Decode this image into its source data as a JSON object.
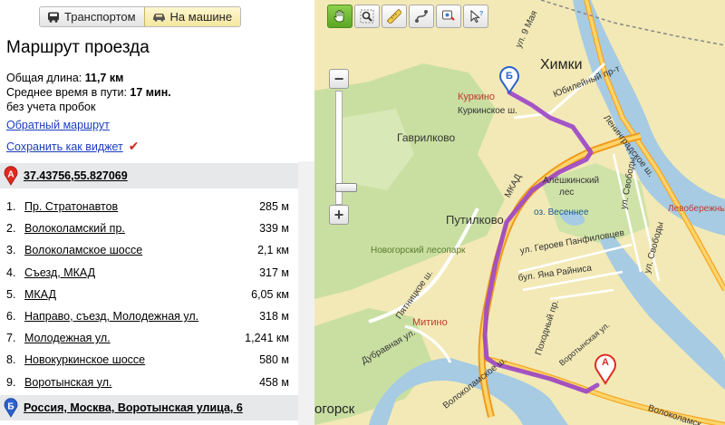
{
  "modes": {
    "transport": "Транспортом",
    "car": "На машине"
  },
  "route": {
    "title": "Маршрут проезда",
    "length_label": "Общая длина:",
    "length_value": "11,7 км",
    "time_label": "Среднее время в пути:",
    "time_value": "17 мин.",
    "traffic_note": "без учета пробок",
    "reverse_link": "Обратный маршрут",
    "widget_link": "Сохранить как виджет",
    "start": {
      "marker": "А",
      "address": "37.43756,55.827069"
    },
    "end": {
      "marker": "Б",
      "address": "Россия, Москва, Воротынская улица, 6"
    },
    "steps": [
      {
        "num": "1.",
        "name": "Пр. Стратонавтов",
        "dist": "285 м"
      },
      {
        "num": "2.",
        "name": "Волоколамский пр.",
        "dist": "339 м"
      },
      {
        "num": "3.",
        "name": "Волоколамское шоссе",
        "dist": "2,1 км"
      },
      {
        "num": "4.",
        "name": "Съезд, МКАД",
        "dist": "317 м"
      },
      {
        "num": "5.",
        "name": "МКАД",
        "dist": "6,05 км"
      },
      {
        "num": "6.",
        "name": "Направо, съезд, Молодежная ул.",
        "dist": "318 м"
      },
      {
        "num": "7.",
        "name": "Молодежная ул.",
        "dist": "1,241 км"
      },
      {
        "num": "8.",
        "name": "Новокуркинское шоссе",
        "dist": "580 м"
      },
      {
        "num": "9.",
        "name": "Воротынская ул.",
        "dist": "458 м"
      }
    ]
  },
  "map": {
    "labels": {
      "khimki": "Химки",
      "kurkino": "Куркино",
      "kurkinskoe": "Куркинское ш.",
      "gavrilkovo": "Гаврилково",
      "putilkovo": "Путилково",
      "mkad": "МКАД",
      "aleshkinsky": "Алёшкинский",
      "les": "лес",
      "ozero": "оз. Весеннее",
      "novogorsky": "Новогорский лесопарк",
      "levoberezhny": "Левобережный",
      "leningradskoe": "Ленинградское ш.",
      "svobody1": "ул. Свободы",
      "svobody2": "ул. Свободы",
      "yubileyny": "Юбилейный пр-т",
      "geroev": "ул. Героев Панфиловцев",
      "rainisa": "бул. Яна Райниса",
      "pyatnitskoe": "Пятницкое ш.",
      "dubravnaya": "Дубравная ул.",
      "mitino": "Митино",
      "pokhodny": "Походный пр.",
      "volokolamskoe1": "Волоколамское ш.",
      "volokolamskoe2": "Волоколамск",
      "ul9maya": "ул. 9 Мая",
      "vorotynskaya": "Воротынская ул.",
      "krasnogorsk": "огорск"
    }
  },
  "colors": {
    "route": "#9b45c9",
    "link": "#1a3dc1",
    "endpoint_bg": "#e7e8ea",
    "pin_a": "#e02a1f",
    "pin_b": "#2a62d0"
  },
  "icons": [
    "bus-icon",
    "car-icon",
    "hand-icon",
    "magnifier-icon",
    "ruler-icon",
    "route-icon",
    "add-object-icon",
    "info-cursor-icon",
    "zoom-in-icon",
    "zoom-out-icon",
    "checkmark-icon"
  ]
}
